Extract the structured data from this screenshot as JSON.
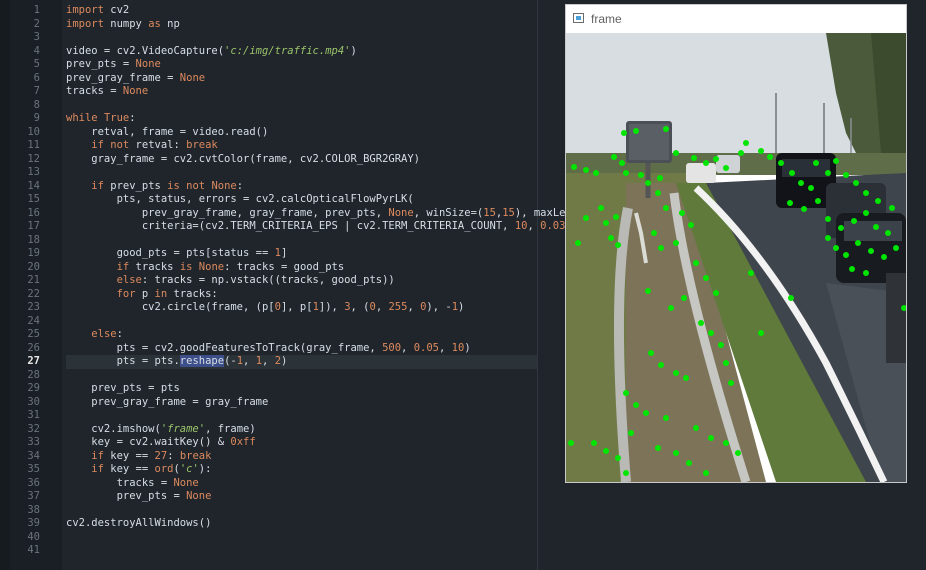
{
  "editor": {
    "active_line": 27,
    "line_numbers": [
      "1",
      "2",
      "3",
      "4",
      "5",
      "6",
      "7",
      "8",
      "9",
      "10",
      "11",
      "12",
      "13",
      "14",
      "15",
      "16",
      "17",
      "18",
      "19",
      "20",
      "21",
      "22",
      "23",
      "24",
      "25",
      "26",
      "27",
      "28",
      "29",
      "30",
      "31",
      "32",
      "33",
      "34",
      "35",
      "36",
      "37",
      "38",
      "39",
      "40",
      "41"
    ]
  },
  "window": {
    "title": "frame"
  },
  "colors": {
    "background": "#1f252b",
    "keyword": "#dd8a5e",
    "string": "#9bc46a",
    "text": "#d7dee5",
    "track_point": "#00e600"
  }
}
